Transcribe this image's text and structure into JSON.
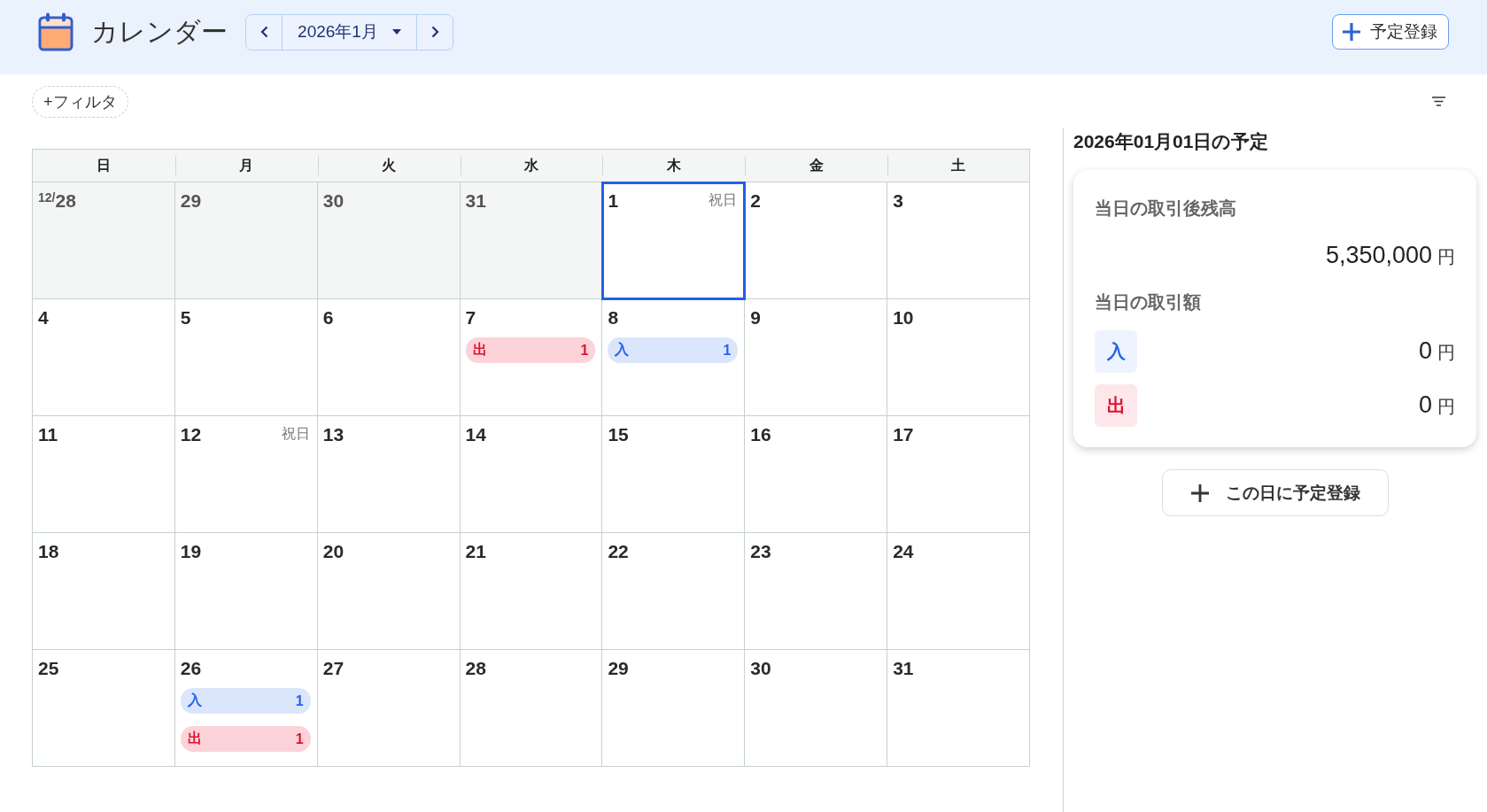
{
  "header": {
    "title": "カレンダー",
    "month_nav": {
      "label": "2026年1月"
    },
    "add_button": {
      "label": "予定登録"
    }
  },
  "toolbar": {
    "filter_button": {
      "label": "+フィルタ"
    }
  },
  "calendar": {
    "weekdays": [
      "日",
      "月",
      "火",
      "水",
      "木",
      "金",
      "土"
    ],
    "weeks": [
      [
        {
          "month_prefix": "12/",
          "date": "28",
          "outside_month": true,
          "selected": false
        },
        {
          "date": "29",
          "outside_month": true,
          "selected": false
        },
        {
          "date": "30",
          "outside_month": true,
          "selected": false
        },
        {
          "date": "31",
          "outside_month": true,
          "selected": false
        },
        {
          "date": "1",
          "holiday": "祝日",
          "outside_month": false,
          "selected": true
        },
        {
          "date": "2",
          "outside_month": false,
          "selected": false
        },
        {
          "date": "3",
          "outside_month": false,
          "selected": false
        }
      ],
      [
        {
          "date": "4",
          "outside_month": false,
          "selected": false
        },
        {
          "date": "5",
          "outside_month": false,
          "selected": false
        },
        {
          "date": "6",
          "outside_month": false,
          "selected": false
        },
        {
          "date": "7",
          "outside_month": false,
          "selected": false,
          "events": [
            {
              "kind": "out",
              "label": "出",
              "count": "1"
            }
          ]
        },
        {
          "date": "8",
          "outside_month": false,
          "selected": false,
          "events": [
            {
              "kind": "in",
              "label": "入",
              "count": "1"
            }
          ]
        },
        {
          "date": "9",
          "outside_month": false,
          "selected": false
        },
        {
          "date": "10",
          "outside_month": false,
          "selected": false
        }
      ],
      [
        {
          "date": "11",
          "outside_month": false,
          "selected": false
        },
        {
          "date": "12",
          "holiday": "祝日",
          "outside_month": false,
          "selected": false
        },
        {
          "date": "13",
          "outside_month": false,
          "selected": false
        },
        {
          "date": "14",
          "outside_month": false,
          "selected": false
        },
        {
          "date": "15",
          "outside_month": false,
          "selected": false
        },
        {
          "date": "16",
          "outside_month": false,
          "selected": false
        },
        {
          "date": "17",
          "outside_month": false,
          "selected": false
        }
      ],
      [
        {
          "date": "18",
          "outside_month": false,
          "selected": false
        },
        {
          "date": "19",
          "outside_month": false,
          "selected": false
        },
        {
          "date": "20",
          "outside_month": false,
          "selected": false
        },
        {
          "date": "21",
          "outside_month": false,
          "selected": false
        },
        {
          "date": "22",
          "outside_month": false,
          "selected": false
        },
        {
          "date": "23",
          "outside_month": false,
          "selected": false
        },
        {
          "date": "24",
          "outside_month": false,
          "selected": false
        }
      ],
      [
        {
          "date": "25",
          "outside_month": false,
          "selected": false
        },
        {
          "date": "26",
          "outside_month": false,
          "selected": false,
          "events": [
            {
              "kind": "in",
              "label": "入",
              "count": "1"
            },
            {
              "kind": "out",
              "label": "出",
              "count": "1"
            }
          ]
        },
        {
          "date": "27",
          "outside_month": false,
          "selected": false
        },
        {
          "date": "28",
          "outside_month": false,
          "selected": false
        },
        {
          "date": "29",
          "outside_month": false,
          "selected": false
        },
        {
          "date": "30",
          "outside_month": false,
          "selected": false
        },
        {
          "date": "31",
          "outside_month": false,
          "selected": false
        }
      ]
    ]
  },
  "day_panel": {
    "title": "2026年01月01日の予定",
    "balance": {
      "label": "当日の取引後残高",
      "amount": "5,350,000",
      "unit": "円"
    },
    "transactions": {
      "label": "当日の取引額",
      "rows": [
        {
          "kind": "in",
          "badge": "入",
          "amount": "0",
          "unit": "円"
        },
        {
          "kind": "out",
          "badge": "出",
          "amount": "0",
          "unit": "円"
        }
      ]
    },
    "add_button": {
      "label": "この日に予定登録"
    }
  }
}
